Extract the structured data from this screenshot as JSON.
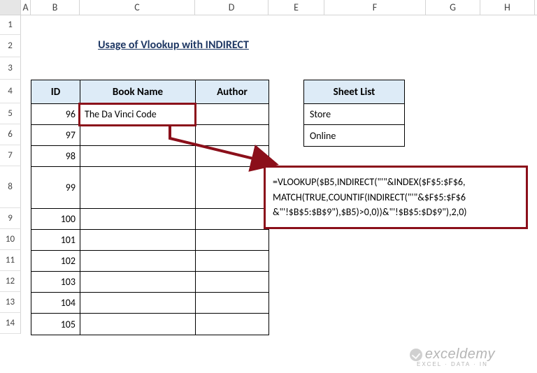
{
  "columns": [
    "A",
    "B",
    "C",
    "D",
    "E",
    "F",
    "G",
    "H"
  ],
  "rows": [
    "1",
    "2",
    "3",
    "4",
    "5",
    "6",
    "7",
    "8",
    "9",
    "10",
    "11",
    "12",
    "13",
    "14"
  ],
  "title": "Usage of Vlookup with INDIRECT",
  "mainTable": {
    "headers": {
      "id": "ID",
      "book": "Book Name",
      "author": "Author"
    },
    "rows": [
      {
        "id": "96",
        "book": "The Da Vinci Code",
        "author": ""
      },
      {
        "id": "97",
        "book": "",
        "author": ""
      },
      {
        "id": "98",
        "book": "",
        "author": ""
      },
      {
        "id": "99",
        "book": "",
        "author": ""
      },
      {
        "id": "100",
        "book": "",
        "author": ""
      },
      {
        "id": "101",
        "book": "",
        "author": ""
      },
      {
        "id": "102",
        "book": "",
        "author": ""
      },
      {
        "id": "103",
        "book": "",
        "author": ""
      },
      {
        "id": "104",
        "book": "",
        "author": ""
      },
      {
        "id": "105",
        "book": "",
        "author": ""
      }
    ]
  },
  "sheetList": {
    "header": "Sheet List",
    "items": [
      "Store",
      "Online"
    ]
  },
  "formula": {
    "line1": "=VLOOKUP($B5,INDIRECT(\"'\"&INDEX($F$5:$F$6,",
    "line2": "MATCH(TRUE,COUNTIF(INDIRECT(\"'\"&$F$5:$F$6",
    "line3": "&\"'!$B$5:$B$9\"),$B5)>0,0))&\"'!$B$5:$D$9\"),2,0)"
  },
  "watermark": {
    "main": "exceldemy",
    "sub": "EXCEL · DATA · IN"
  },
  "chart_data": {
    "type": "table",
    "tables": [
      {
        "name": "main",
        "columns": [
          "ID",
          "Book Name",
          "Author"
        ],
        "rows": [
          [
            "96",
            "The Da Vinci Code",
            ""
          ],
          [
            "97",
            "",
            ""
          ],
          [
            "98",
            "",
            ""
          ],
          [
            "99",
            "",
            ""
          ],
          [
            "100",
            "",
            ""
          ],
          [
            "101",
            "",
            ""
          ],
          [
            "102",
            "",
            ""
          ],
          [
            "103",
            "",
            ""
          ],
          [
            "104",
            "",
            ""
          ],
          [
            "105",
            "",
            ""
          ]
        ]
      },
      {
        "name": "sheet_list",
        "columns": [
          "Sheet List"
        ],
        "rows": [
          [
            "Store"
          ],
          [
            "Online"
          ]
        ]
      }
    ]
  }
}
